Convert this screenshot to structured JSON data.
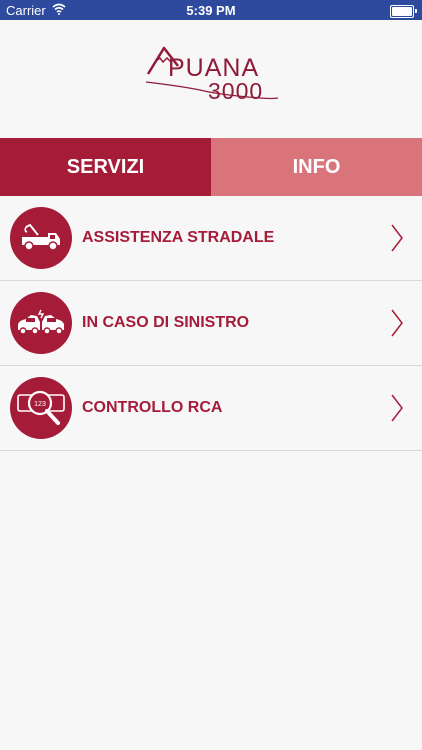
{
  "status_bar": {
    "carrier": "Carrier",
    "time": "5:39 PM",
    "battery_level": 1.0
  },
  "logo": {
    "word": "PUANA",
    "number": "3000"
  },
  "tabs": [
    {
      "label": "SERVIZI",
      "active": true
    },
    {
      "label": "INFO",
      "active": false
    }
  ],
  "menu": {
    "items": [
      {
        "label": "ASSISTENZA STRADALE",
        "icon": "tow-truck-icon"
      },
      {
        "label": "IN CASO DI SINISTRO",
        "icon": "car-crash-icon"
      },
      {
        "label": "CONTROLLO RCA",
        "icon": "license-plate-search-icon"
      }
    ]
  },
  "colors": {
    "primary": "#a51c39",
    "tab_inactive": "#d9757a",
    "status_bar": "#2e4a9e",
    "background": "#f7f7f7"
  }
}
